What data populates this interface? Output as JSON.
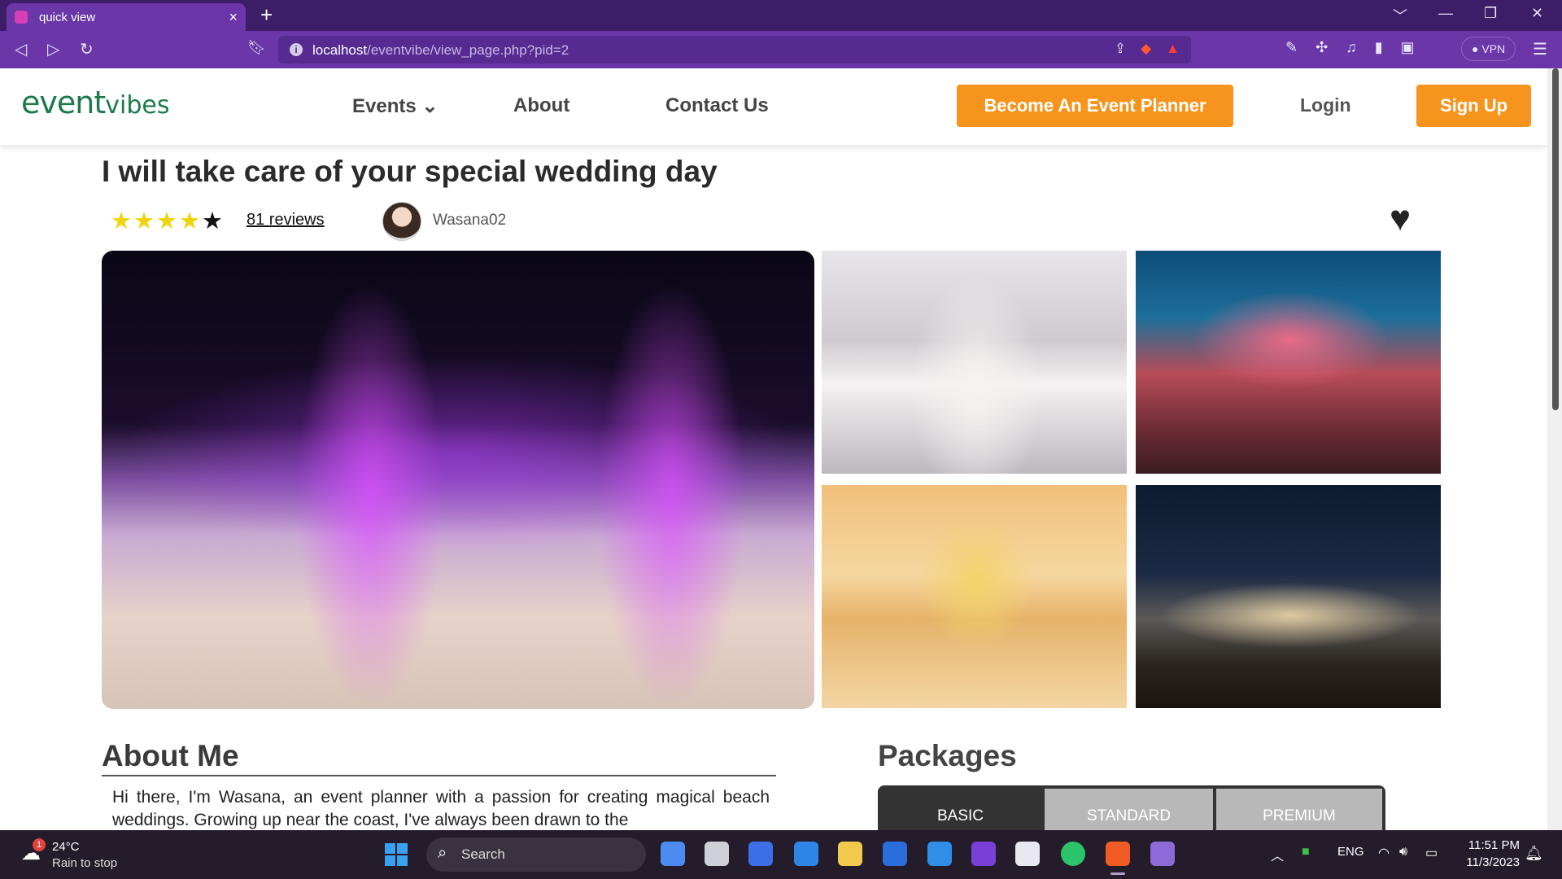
{
  "browser": {
    "tab_title": "quick view",
    "tab_close": "×",
    "new_tab": "+",
    "url_host": "localhost",
    "url_path": "/eventvibe/view_page.php?pid=2",
    "vpn_label": "VPN",
    "window_controls": [
      "﹀",
      "—",
      "❐",
      "✕"
    ]
  },
  "site": {
    "logo_main": "event",
    "logo_sub": "vibes",
    "nav": {
      "events": "Events",
      "events_caret": "⌄",
      "about": "About",
      "contact": "Contact Us"
    },
    "become_planner": "Become An Event Planner",
    "login": "Login",
    "signup": "Sign Up"
  },
  "listing": {
    "title": "I will take care of your special wedding day",
    "rating": 4,
    "rating_max": 5,
    "reviews": "81 reviews",
    "username": "Wasana02",
    "favorite_icon": "heart-icon"
  },
  "about": {
    "heading": "About Me",
    "text": "Hi there, I'm Wasana, an event planner with a passion for creating magical beach weddings. Growing up near the coast, I've always been drawn to the"
  },
  "packages": {
    "heading": "Packages",
    "tabs": [
      "BASIC",
      "STANDARD",
      "PREMIUM"
    ],
    "active": "BASIC"
  },
  "taskbar": {
    "weather_temp": "24°C",
    "weather_desc": "Rain to stop",
    "weather_badge": "1",
    "search": "Search",
    "language": "ENG",
    "time": "11:51 PM",
    "date": "11/3/2023"
  },
  "colors": {
    "brand_green": "#1d7a4b",
    "accent_orange": "#f7941d",
    "browser_purple": "#6a36a8",
    "star_yellow": "#f1d30c"
  }
}
